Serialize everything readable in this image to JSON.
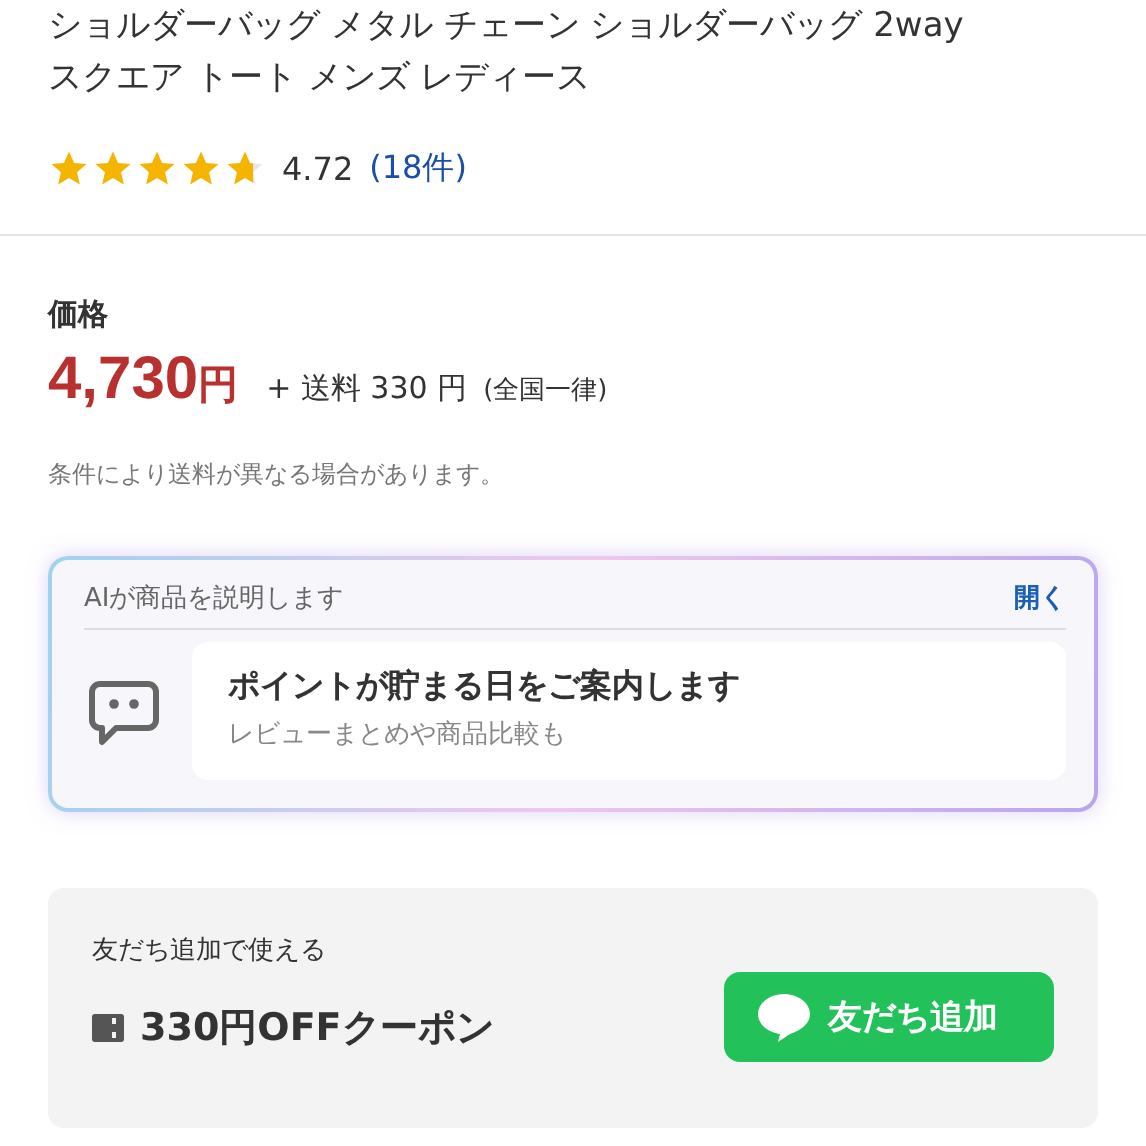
{
  "product": {
    "title_lines": [
      "ショルダーバッグ メタル チェーン ショルダーバッグ 2way",
      "スクエア トート メンズ レディース"
    ],
    "stars": 4.72,
    "rating": "4.72",
    "review_count": "(18件)"
  },
  "price": {
    "label": "価格",
    "amount": "4,730",
    "currency": "円",
    "shipping": "+ 送料 330 円",
    "shipping_note": "(全国一律)",
    "condition": "条件により送料が異なる場合があります。"
  },
  "ai_summary": {
    "heading": "AIが商品を説明します",
    "open_link": "開く",
    "title": "ポイントが貯まる日をご案内します",
    "subtitle": "レビューまとめや商品比較も"
  },
  "coupon": {
    "caption": "友だち追加で使える",
    "title": "330円OFFクーポン",
    "button": "友だち追加"
  }
}
